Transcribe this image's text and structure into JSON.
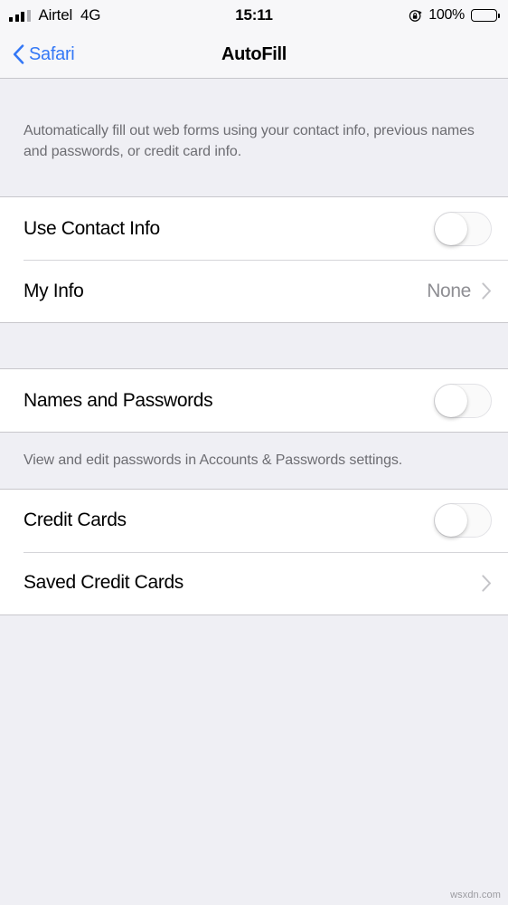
{
  "status_bar": {
    "carrier": "Airtel",
    "network": "4G",
    "time": "15:11",
    "battery_percent": "100%",
    "signal_bars_filled": 3,
    "signal_bars_total": 4,
    "rotation_lock_icon": "rotation-lock-icon",
    "battery_icon": "battery-icon"
  },
  "nav_bar": {
    "back_label": "Safari",
    "back_icon": "chevron-left-icon",
    "title": "AutoFill",
    "back_tint": "#3478f6"
  },
  "intro": {
    "text": "Automatically fill out web forms using your contact info, previous names and passwords, or credit card info."
  },
  "groups": [
    {
      "id": "contact-group",
      "rows": [
        {
          "name": "use-contact-info",
          "label": "Use Contact Info",
          "control": "toggle",
          "toggle_on": false
        },
        {
          "name": "my-info",
          "label": "My Info",
          "control": "disclosure",
          "value": "None",
          "chevron_icon": "chevron-right-icon"
        }
      ],
      "footer": ""
    },
    {
      "id": "passwords-group",
      "rows": [
        {
          "name": "names-and-passwords",
          "label": "Names and Passwords",
          "control": "toggle",
          "toggle_on": false
        }
      ],
      "footer": "View and edit passwords in Accounts & Passwords settings."
    },
    {
      "id": "credit-cards-group",
      "rows": [
        {
          "name": "credit-cards",
          "label": "Credit Cards",
          "control": "toggle",
          "toggle_on": false
        },
        {
          "name": "saved-credit-cards",
          "label": "Saved Credit Cards",
          "control": "disclosure",
          "value": "",
          "chevron_icon": "chevron-right-icon"
        }
      ],
      "footer": ""
    }
  ],
  "watermark": "wsxdn.com",
  "colors": {
    "background": "#efeff4",
    "row_background": "#ffffff",
    "separator": "#c8c7cc",
    "secondary_text": "#6d6d72",
    "value_text": "#8e8e93",
    "tint": "#3478f6"
  }
}
